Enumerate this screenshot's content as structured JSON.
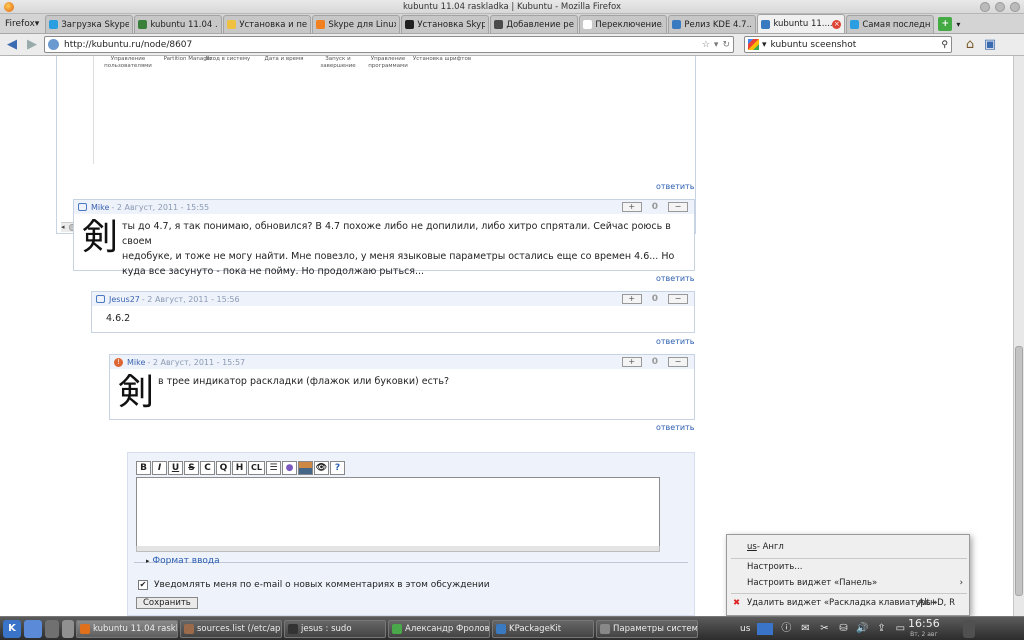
{
  "window": {
    "title": "kubuntu 11.04 raskladka | Kubuntu - Mozilla Firefox"
  },
  "firefox_menu": "Firefox",
  "tabs": [
    {
      "label": "Загрузка Skype ...",
      "color": "#2a9ee0"
    },
    {
      "label": "kubuntu 11.04 ...",
      "color": "#3a7f3a"
    },
    {
      "label": "Установка и пе...",
      "color": "#f0c040"
    },
    {
      "label": "Skype для Linux...",
      "color": "#f08020"
    },
    {
      "label": "Установка Skyp...",
      "color": "#202020"
    },
    {
      "label": "Добавление ре...",
      "color": "#4a4a4a"
    },
    {
      "label": "Переключение...",
      "color": "#ffffff"
    },
    {
      "label": "Релиз KDE 4.7....",
      "color": "#3a7ac0"
    },
    {
      "label": "kubuntu 11....",
      "color": "#3a7ac0",
      "active": true
    },
    {
      "label": "Самая последн...",
      "color": "#2a9ee0"
    }
  ],
  "nav": {
    "url": "http://kubuntu.ru/node/8607",
    "search_engine": "Google",
    "search_value": "kubuntu sceenshot"
  },
  "screenshot_icons": [
    "Управление пользователями",
    "Partition Manager",
    "Вход в систему",
    "Дата и время",
    "Запуск и завершение",
    "Управление программами",
    "Установка шрифтов"
  ],
  "reply_label": "ответить",
  "comments": [
    {
      "author": "Mike",
      "date": "- 2 Август, 2011 - 15:55",
      "votes": "0",
      "avatar": "剣",
      "text": [
        "ты до 4.7, я так понимаю, обновился? В 4.7 похоже либо не допилили, либо хитро спрятали. Сейчас роюсь в своем",
        "недобуке, и тоже не могу найти. Мне повезло, у меня языковые параметры остались еще со времен 4.6... Но",
        "куда все засунуто - пока не пойму. Но продолжаю рыться..."
      ]
    },
    {
      "author": "Jesus27",
      "date": "- 2 Август, 2011 - 15:56",
      "votes": "0",
      "text": [
        "4.6.2"
      ]
    },
    {
      "author": "Mike",
      "date": "- 2 Август, 2011 - 15:57",
      "votes": "0",
      "avatar": "剣",
      "text": [
        "в трее индикатор раскладки (флажок или буковки) есть?"
      ]
    }
  ],
  "editor": {
    "toolbar": [
      "B",
      "I",
      "U",
      "S",
      "C",
      "Q",
      "H",
      "CL"
    ],
    "input_format": "Формат ввода",
    "notify_label": "Уведомлять меня по e-mail о новых комментариях в этом обсуждении",
    "save_label": "Сохранить"
  },
  "context_menu": {
    "layout_prefix": "us",
    "layout_suffix": " - Англ",
    "configure": "Настроить...",
    "configure_panel": "Настроить виджет «Панель»",
    "remove_widget": "Удалить виджет «Раскладка клавиатуры»",
    "remove_shortcut": "Alt+D, R"
  },
  "taskbar": {
    "tasks": [
      {
        "label": "kubuntu 11.04 raskl",
        "color": "#e0701c",
        "active": true
      },
      {
        "label": "sources.list (/etc/ap",
        "color": "#9a6a4a"
      },
      {
        "label": "jesus : sudo",
        "color": "#333333"
      },
      {
        "label": "Александр Фролов",
        "color": "#4aa84a"
      },
      {
        "label": "KPackageKit",
        "color": "#3a7ac0"
      },
      {
        "label": "Параметры системы",
        "color": "#888888"
      }
    ],
    "keyboard_layout": "us",
    "clock_time": "16:56",
    "clock_date": "Вт, 2 авг"
  }
}
